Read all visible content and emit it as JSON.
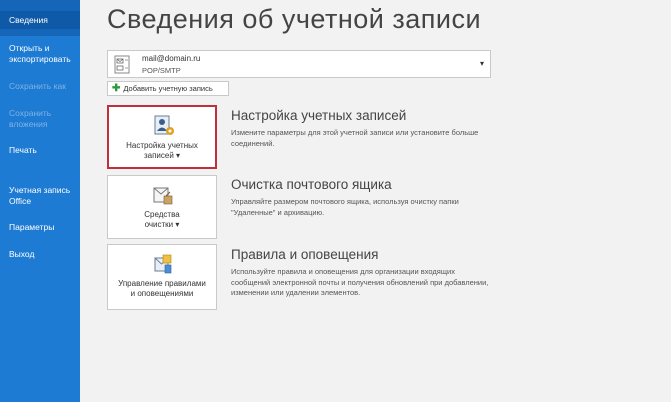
{
  "sidebar": {
    "items": [
      {
        "label": "Сведения",
        "active": true,
        "disabled": false
      },
      {
        "label": "Открыть и экспортировать",
        "active": false,
        "disabled": false
      },
      {
        "label": "Сохранить как",
        "active": false,
        "disabled": true
      },
      {
        "label": "Сохранить вложения",
        "active": false,
        "disabled": true
      },
      {
        "label": "Печать",
        "active": false,
        "disabled": false
      },
      {
        "label": "Учетная запись Office",
        "active": false,
        "disabled": false
      },
      {
        "label": "Параметры",
        "active": false,
        "disabled": false
      },
      {
        "label": "Выход",
        "active": false,
        "disabled": false
      }
    ]
  },
  "page": {
    "title": "Сведения об учетной записи"
  },
  "account": {
    "email": "mail@domain.ru",
    "type": "POP/SMTP"
  },
  "add_account": {
    "label": "Добавить учетную запись"
  },
  "sections": [
    {
      "tile_label_line1": "Настройка учетных",
      "tile_label_line2": "записей ▾",
      "heading": "Настройка учетных записей",
      "description": "Измените параметры для этой учетной записи или установите больше соединений."
    },
    {
      "tile_label_line1": "Средства",
      "tile_label_line2": "очистки ▾",
      "heading": "Очистка почтового ящика",
      "description": "Управляйте размером почтового ящика, используя очистку папки \"Удаленные\" и архивацию."
    },
    {
      "tile_label_line1": "Управление правилами",
      "tile_label_line2": "и оповещениями",
      "heading": "Правила и оповещения",
      "description": "Используйте правила и оповещения для организации входящих сообщений электронной почты и получения обновлений при добавлении, изменении или удалении элементов."
    }
  ],
  "colors": {
    "sidebar": "#1e7bd3",
    "active": "#0f5aa8",
    "selected_border": "#c0303a"
  }
}
